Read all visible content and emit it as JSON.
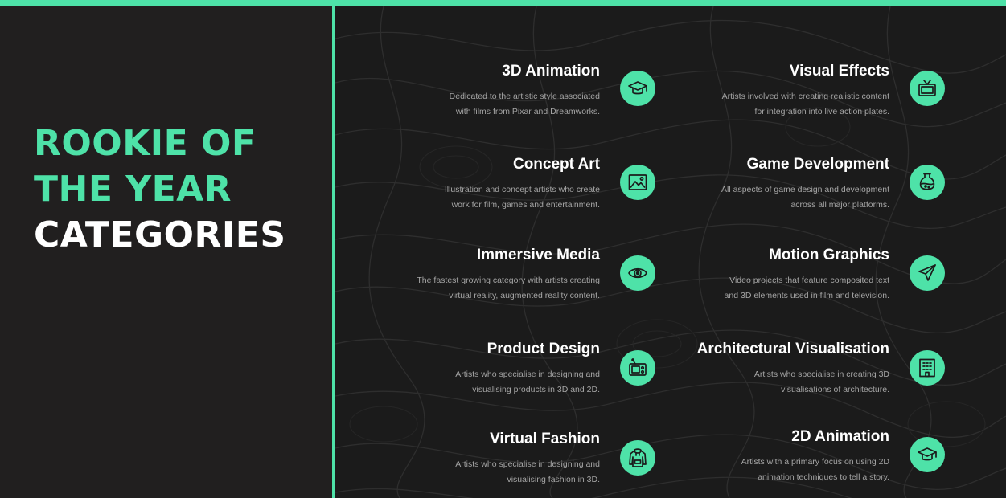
{
  "heading": {
    "line1": "ROOKIE OF",
    "line2": "THE YEAR",
    "line3": "CATEGORIES"
  },
  "colors": {
    "accent": "#4ee2a8",
    "left_background": "#211f1f",
    "right_background": "#1b1b1b",
    "title_text": "#ffffff",
    "description_text": "#a5a5a5"
  },
  "categories": [
    {
      "title": "3D Animation",
      "desc_line1": "Dedicated to the artistic style associated",
      "desc_line2": "with films from Pixar and Dreamworks.",
      "icon": "graduation-cap-icon"
    },
    {
      "title": "Visual Effects",
      "desc_line1": "Artists involved with creating realistic content",
      "desc_line2": "for integration into live action plates.",
      "icon": "tv-icon"
    },
    {
      "title": "Concept Art",
      "desc_line1": "Illustration and concept artists who create",
      "desc_line2": "work for film, games and entertainment.",
      "icon": "picture-icon"
    },
    {
      "title": "Game Development",
      "desc_line1": "All aspects of game design and development",
      "desc_line2": "across all major platforms.",
      "icon": "potion-flask-icon"
    },
    {
      "title": "Immersive Media",
      "desc_line1": "The fastest growing category with artists creating",
      "desc_line2": "virtual reality, augmented reality content.",
      "icon": "eye-icon"
    },
    {
      "title": "Motion Graphics",
      "desc_line1": "Video projects that feature composited text",
      "desc_line2": "and 3D elements used in film and television.",
      "icon": "paper-plane-icon"
    },
    {
      "title": "Product Design",
      "desc_line1": "Artists who specialise in designing and",
      "desc_line2": "visualising products in 3D and 2D.",
      "icon": "radio-icon"
    },
    {
      "title": "Architectural Visualisation",
      "desc_line1": "Artists who specialise in creating 3D",
      "desc_line2": "visualisations of architecture.",
      "icon": "building-icon"
    },
    {
      "title": "Virtual Fashion",
      "desc_line1": "Artists who specialise in designing and",
      "desc_line2": "visualising fashion in 3D.",
      "icon": "hoodie-icon"
    },
    {
      "title": "2D Animation",
      "desc_line1": "Artists with a primary focus on using 2D",
      "desc_line2": "animation techniques to tell a story.",
      "icon": "graduation-cap-icon"
    }
  ]
}
